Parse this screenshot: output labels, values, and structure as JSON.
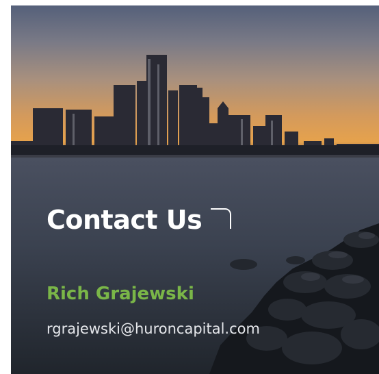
{
  "contact": {
    "heading": "Contact Us",
    "name": "Rich Grajewski",
    "email": "rgrajewski@huroncapital.com"
  },
  "colors": {
    "heading": "#ffffff",
    "name_accent": "#7ab648",
    "email": "#e6e8ec"
  }
}
